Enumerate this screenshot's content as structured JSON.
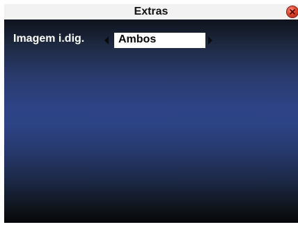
{
  "window": {
    "title": "Extras",
    "close_icon": "close-icon"
  },
  "settings": {
    "row": {
      "label": "Imagem i.dig.",
      "value": "Ambos",
      "prev_icon": "arrow-left-icon",
      "next_icon": "arrow-right-icon"
    }
  },
  "colors": {
    "title_bar": "#f2f2f2",
    "panel_center": "#2d4386",
    "panel_edge": "#060709",
    "text_light": "#ffffff",
    "close_red": "#e0452f"
  }
}
